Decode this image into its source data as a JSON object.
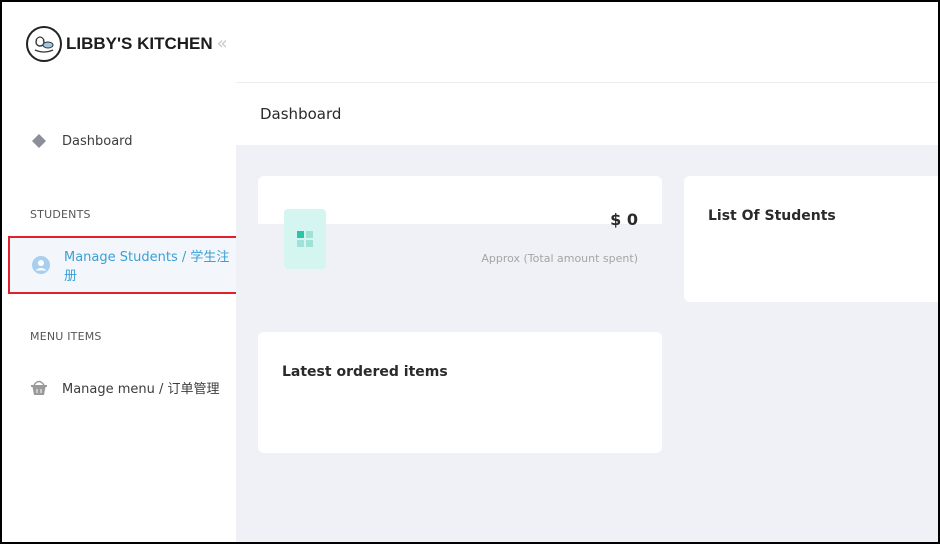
{
  "brand": {
    "name": "LIBBY'S KITCHEN",
    "collapse_icon": "double-chevron-left-icon"
  },
  "sidebar": {
    "dashboard": {
      "label": "Dashboard",
      "icon": "diamond-icon"
    },
    "students_section": "STUDENTS",
    "manage_students": {
      "label": "Manage Students / 学生注册",
      "icon": "user-circle-icon"
    },
    "menu_section": "MENU ITEMS",
    "manage_menu": {
      "label": "Manage menu / 订单管理",
      "icon": "basket-icon"
    }
  },
  "header": {
    "title": "Dashboard"
  },
  "cards": {
    "spent": {
      "amount": "$ 0",
      "caption": "Approx (Total amount spent)",
      "icon": "grid-icon"
    },
    "students": {
      "title": "List Of Students"
    },
    "orders": {
      "title": "Latest ordered items"
    }
  },
  "colors": {
    "active": "#3aa0d6",
    "highlight_border": "#e0202a",
    "main_bg": "#f0f1f6",
    "spent_icon_bg": "#d4f5f0",
    "spent_icon": "#2bc4a8"
  }
}
